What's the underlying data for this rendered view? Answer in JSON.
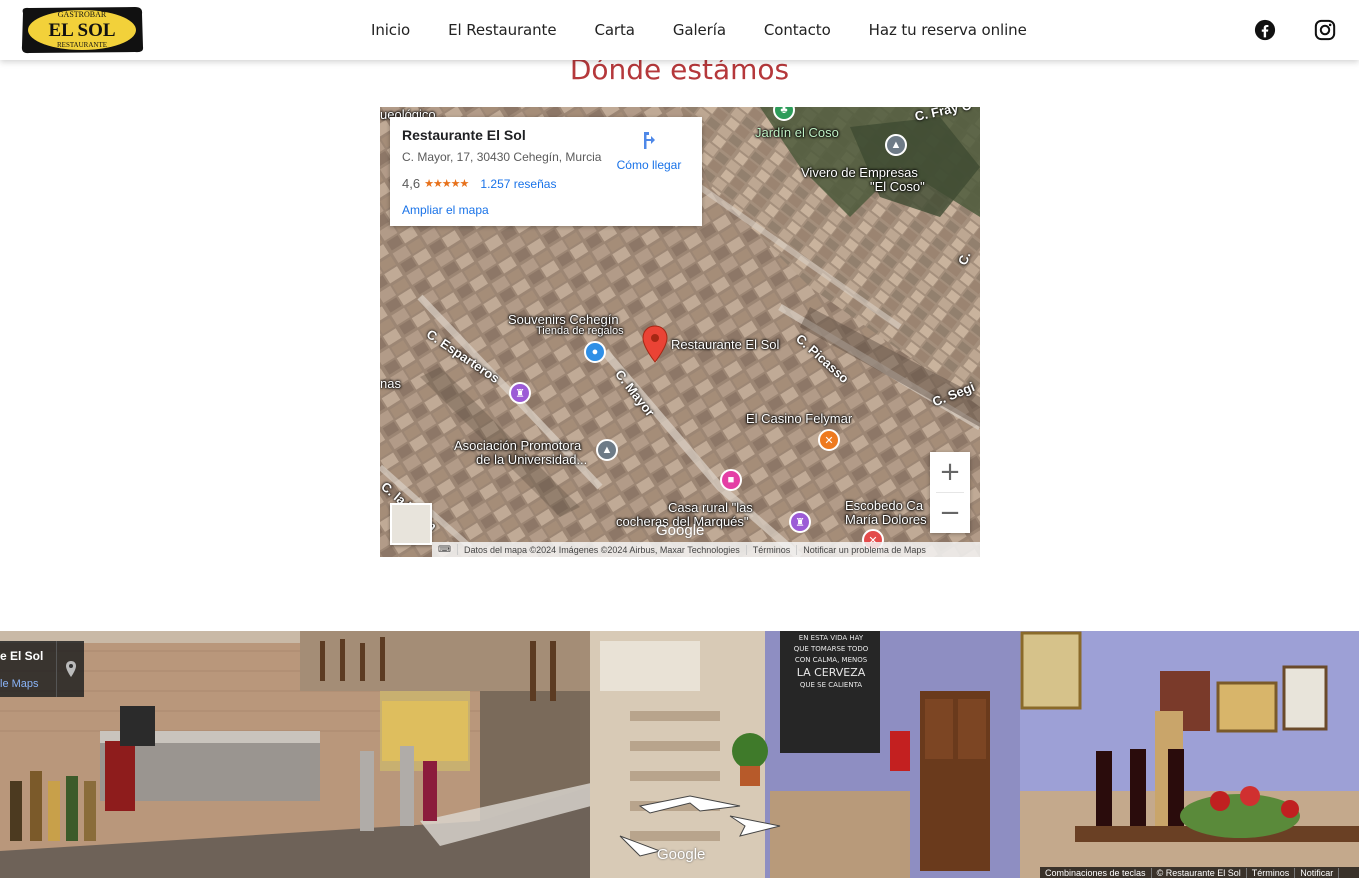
{
  "header": {
    "logo": {
      "top_text": "GASTROBAR",
      "main_text": "EL SOL",
      "bottom_text": "RESTAURANTE"
    },
    "nav": [
      "Inicio",
      "El Restaurante",
      "Carta",
      "Galería",
      "Contacto",
      "Haz tu reserva online"
    ],
    "social": [
      {
        "name": "facebook",
        "icon": "facebook-icon"
      },
      {
        "name": "instagram",
        "icon": "instagram-icon"
      }
    ]
  },
  "section": {
    "title": "Dónde estámos"
  },
  "map": {
    "info_card": {
      "title": "Restaurante El Sol",
      "address": "C. Mayor, 17, 30430 Cehegín, Murcia",
      "rating": "4,6",
      "stars": "★★★★★",
      "reviews": "1.257 reseñas",
      "enlarge": "Ampliar el mapa",
      "directions": "Cómo llegar"
    },
    "labels": {
      "museum_top": "ueológico",
      "garden": "Jardín el Coso",
      "nursery_1": "Vivero de Empresas",
      "nursery_2": "\"El Coso\"",
      "fray": "C. Fray C",
      "souvenirs": "Souvenirs Cehegín",
      "souvenirs_sub": "Tienda de regalos",
      "restaurant": "Restaurante El Sol",
      "casino": "El Casino Felymar",
      "assoc_1": "Asociación Promotora",
      "assoc_2": "de la Universidad...",
      "casa_1": "Casa rural \"las",
      "casa_2": "cocheras del Marqués\"",
      "escobedo_1": "Escobedo Ca",
      "escobedo_2": "María Dolores",
      "nas": "nas"
    },
    "streets": {
      "esparteros": "C. Esparteros",
      "mayor": "C. Mayor",
      "picasso": "C. Picasso",
      "segi": "C. Segi",
      "union": "C. la Unión",
      "c_right": "C."
    },
    "zoom_in": "+",
    "zoom_out": "−",
    "google": "Google",
    "attribution": [
      "Datos del mapa ©2024 Imágenes ©2024 Airbus, Maxar Technologies",
      "Términos",
      "Notificar un problema de Maps"
    ]
  },
  "streetview": {
    "title": "e El Sol",
    "link": "le Maps",
    "google": "Google",
    "chalk_1": "EN ESTA VIDA HAY",
    "chalk_2": "QUE TOMARSE TODO",
    "chalk_3": "CON CALMA, MENOS",
    "chalk_4": "LA CERVEZA",
    "chalk_5": "QUE SE CALIENTA",
    "attribution": [
      "Combinaciones de teclas",
      "© Restaurante El Sol",
      "Términos",
      "Notificar"
    ]
  },
  "colors": {
    "title_red": "#b5383b",
    "link_blue": "#1a73e8",
    "star_orange": "#e7711b",
    "logo_yellow": "#f2d13a"
  }
}
